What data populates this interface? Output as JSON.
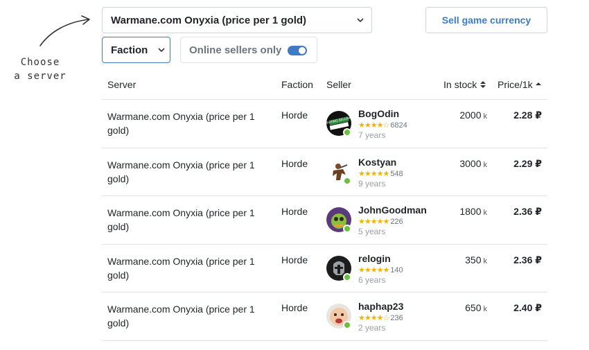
{
  "annotation": {
    "line1": "Choose",
    "line2": "a server"
  },
  "filters": {
    "server_selected": "Warmane.com Onyxia (price per 1 gold)",
    "faction_selected": "Faction",
    "online_only_label": "Online sellers only",
    "online_only_enabled": true,
    "sell_button_label": "Sell game currency"
  },
  "table": {
    "headers": {
      "server": "Server",
      "faction": "Faction",
      "seller": "Seller",
      "stock": "In stock",
      "price": "Price/1k"
    },
    "rows": [
      {
        "server": "Warmane.com Onyxia (price per 1 gold)",
        "faction": "Horde",
        "seller": "BogOdin",
        "stars": "★★★★☆",
        "rating": "6824",
        "years": "7 years",
        "stock": "2000",
        "stock_unit": "k",
        "price": "2.28 ₽"
      },
      {
        "server": "Warmane.com Onyxia (price per 1 gold)",
        "faction": "Horde",
        "seller": "Kostyan",
        "stars": "★★★★★",
        "rating": "548",
        "years": "9 years",
        "stock": "3000",
        "stock_unit": "k",
        "price": "2.29 ₽"
      },
      {
        "server": "Warmane.com Onyxia (price per 1 gold)",
        "faction": "Horde",
        "seller": "JohnGoodman",
        "stars": "★★★★★",
        "rating": "226",
        "years": "5 years",
        "stock": "1800",
        "stock_unit": "k",
        "price": "2.36 ₽"
      },
      {
        "server": "Warmane.com Onyxia (price per 1 gold)",
        "faction": "Horde",
        "seller": "relogin",
        "stars": "★★★★★",
        "rating": "140",
        "years": "6 years",
        "stock": "350",
        "stock_unit": "k",
        "price": "2.36 ₽"
      },
      {
        "server": "Warmane.com Onyxia (price per 1 gold)",
        "faction": "Horde",
        "seller": "haphap23",
        "stars": "★★★★☆",
        "rating": "236",
        "years": "2 years",
        "stock": "650",
        "stock_unit": "k",
        "price": "2.40 ₽"
      }
    ]
  },
  "colors": {
    "accent": "#3d7bc6",
    "online": "#6ac13c",
    "star": "#f2b300"
  },
  "avatar_text": {
    "row0": "BUYING SELLING"
  }
}
